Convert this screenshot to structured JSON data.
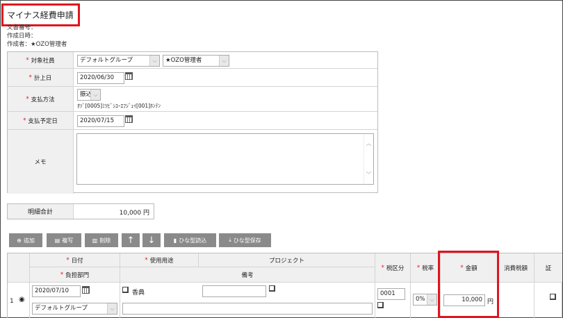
{
  "title": "マイナス経費申請",
  "meta": {
    "doc_no": "文書番号：",
    "created_at": "作成日時：",
    "author": "作成者：★OZO管理者"
  },
  "form": {
    "employee": {
      "label": "対象社員",
      "group": "デフォルトグループ",
      "person": "★OZO管理者"
    },
    "date": {
      "label": "計上日",
      "value": "2020/06/30"
    },
    "payment": {
      "label": "支払方法",
      "method": "振込",
      "account": "ｵｿﾞ[0005]ﾐﾂﾋﾞｼﾕｰｴﾌｼﾞｪｲ[001]ﾎﾝﾃﾝ"
    },
    "pay_date": {
      "label": "支払予定日",
      "value": "2020/07/15"
    },
    "memo": {
      "label": "メモ",
      "value": ""
    }
  },
  "total": {
    "label": "明細合計",
    "value": "10,000 円"
  },
  "toolbar": {
    "add": "追加",
    "copy": "複写",
    "delete": "削除",
    "up": "↑",
    "down": "↓",
    "load_template": "ひな型読込",
    "save_template": "ひな型保存"
  },
  "table": {
    "headers": {
      "date": "日付",
      "department": "負担部門",
      "purpose": "使用用途",
      "project": "プロジェクト",
      "remarks": "備考",
      "tax_category": "税区分",
      "tax_rate": "税率",
      "amount": "金額",
      "consumption_tax": "消費税額",
      "receipt": "証"
    },
    "rows": [
      {
        "no": "1",
        "date": "2020/07/10",
        "department": "デフォルトグループ",
        "purpose": "香典",
        "project": "",
        "tax_category": "0001",
        "tax_rate": "0%",
        "amount": "10,000",
        "unit": "円"
      }
    ]
  }
}
